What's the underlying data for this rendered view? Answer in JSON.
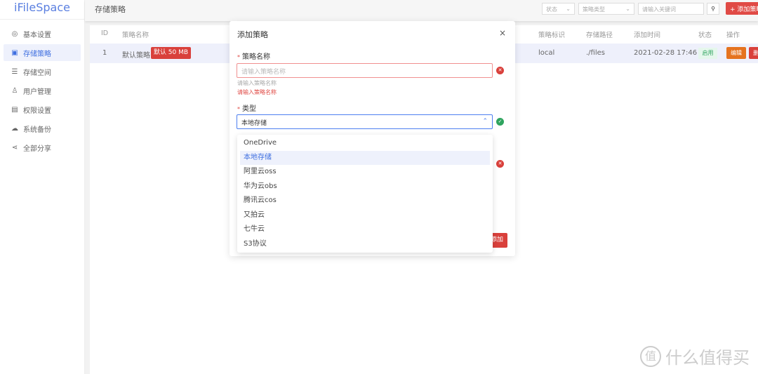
{
  "app": {
    "logo": "iFileSpace",
    "page_title": "存储策略"
  },
  "sidebar": {
    "items": [
      {
        "label": "基本设置",
        "icon": "gear-icon"
      },
      {
        "label": "存储策略",
        "icon": "save-icon",
        "active": true
      },
      {
        "label": "存储空间",
        "icon": "storage-icon"
      },
      {
        "label": "用户管理",
        "icon": "user-icon"
      },
      {
        "label": "权限设置",
        "icon": "image-icon"
      },
      {
        "label": "系统备份",
        "icon": "cloud-upload-icon"
      },
      {
        "label": "全部分享",
        "icon": "share-icon"
      }
    ]
  },
  "toolbar": {
    "status_placeholder": "状态",
    "type_placeholder": "策略类型",
    "search_placeholder": "请输入关键词",
    "add_label": "+ 添加策略"
  },
  "table": {
    "headers": [
      "ID",
      "策略名称",
      "策略标识",
      "存储路径",
      "添加时间",
      "状态",
      "操作"
    ],
    "rows": [
      {
        "id": "1",
        "name": "默认策略",
        "tag": "默认 50 MB",
        "key": "local",
        "path": "./files",
        "time": "2021-02-28 17:46",
        "status": "启用",
        "edit": "编辑",
        "delete": "删除"
      }
    ]
  },
  "modal": {
    "title": "添加策略",
    "close": "×",
    "name_label": "策略名称",
    "name_placeholder": "请输入策略名称",
    "name_hint": "请输入策略名称",
    "name_error": "请输入策略名称",
    "type_label": "类型",
    "type_value": "本地存储",
    "submit": "添加",
    "options": [
      "OneDrive",
      "本地存储",
      "阿里云oss",
      "华为云obs",
      "腾讯云cos",
      "又拍云",
      "七牛云",
      "S3协议"
    ],
    "selected": "本地存储"
  },
  "watermark": {
    "text": "什么值得买",
    "seal": "值"
  },
  "colors": {
    "accent": "#3f6fe0",
    "danger": "#d9403b",
    "warning": "#e5731f",
    "success": "#2fa45f"
  }
}
